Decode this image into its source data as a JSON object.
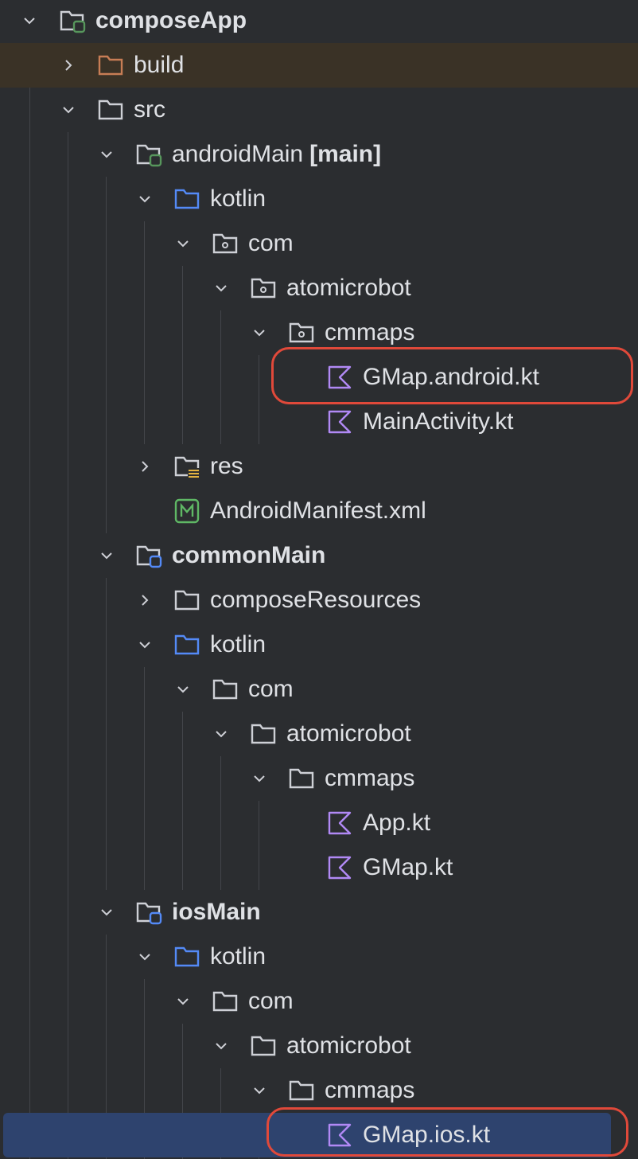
{
  "tree": {
    "rows": [
      {
        "label": "composeApp",
        "bold": true,
        "expanded": true
      },
      {
        "label": "build",
        "expanded": false
      },
      {
        "label": "src",
        "expanded": true
      },
      {
        "label": "androidMain",
        "suffix": "[main]",
        "expanded": true
      },
      {
        "label": "kotlin",
        "expanded": true
      },
      {
        "label": "com",
        "expanded": true
      },
      {
        "label": "atomicrobot",
        "expanded": true
      },
      {
        "label": "cmmaps",
        "expanded": true
      },
      {
        "label": "GMap.android.kt"
      },
      {
        "label": "MainActivity.kt"
      },
      {
        "label": "res",
        "expanded": false
      },
      {
        "label": "AndroidManifest.xml"
      },
      {
        "label": "commonMain",
        "bold": true,
        "expanded": true
      },
      {
        "label": "composeResources",
        "expanded": false
      },
      {
        "label": "kotlin",
        "expanded": true
      },
      {
        "label": "com",
        "expanded": true
      },
      {
        "label": "atomicrobot",
        "expanded": true
      },
      {
        "label": "cmmaps",
        "expanded": true
      },
      {
        "label": "App.kt"
      },
      {
        "label": "GMap.kt"
      },
      {
        "label": "iosMain",
        "bold": true,
        "expanded": true
      },
      {
        "label": "kotlin",
        "expanded": true
      },
      {
        "label": "com",
        "expanded": true
      },
      {
        "label": "atomicrobot",
        "expanded": true
      },
      {
        "label": "cmmaps",
        "expanded": true
      },
      {
        "label": "GMap.ios.kt",
        "selected": true
      }
    ],
    "highlighted": [
      "GMap.android.kt",
      "GMap.ios.kt"
    ]
  },
  "colors": {
    "background": "#2b2d30",
    "text": "#dfe1e5",
    "folder_gray": "#ced0d6",
    "folder_blue": "#548af7",
    "folder_orange": "#c77d55",
    "kotlin_purple": "#b189f5",
    "manifest_green": "#5fb865",
    "module_green": "#57965c",
    "source_blue": "#548af7",
    "highlight_red": "#e0493a",
    "selection": "#2e436e"
  }
}
